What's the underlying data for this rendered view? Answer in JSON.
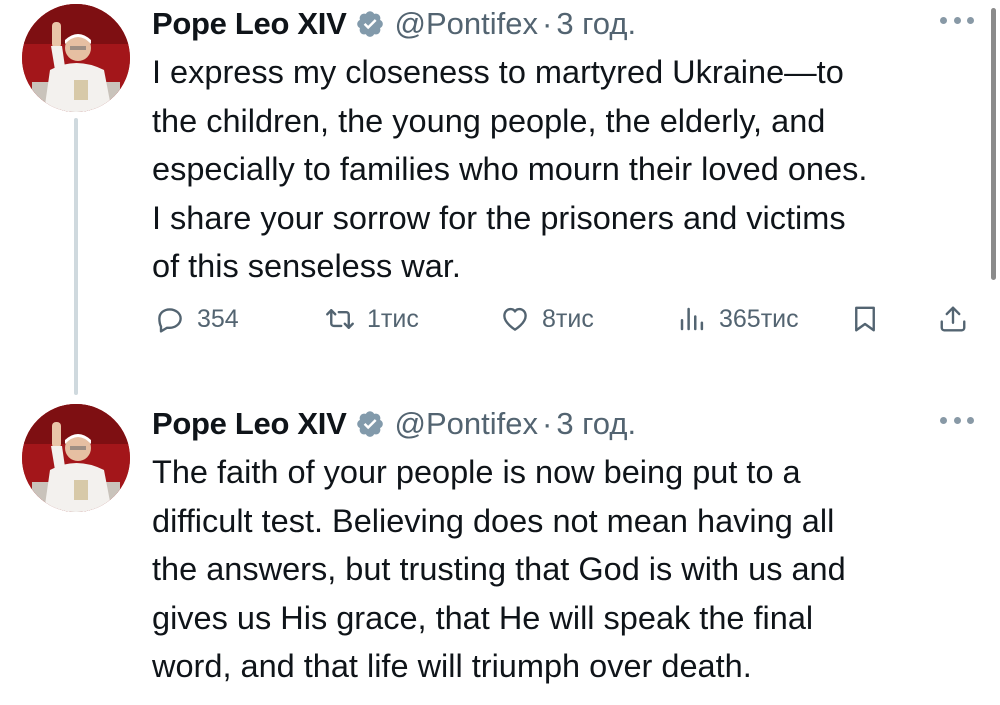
{
  "colors": {
    "text": "#0f1419",
    "secondary": "#536471",
    "verified_badge": "#829aab"
  },
  "tweets": [
    {
      "author_name": "Pope Leo XIV",
      "handle": "@Pontifex",
      "separator": "·",
      "time": "3 год.",
      "text_lines": [
        "I express my closeness to martyred Ukraine—to",
        "the children, the young people, the elderly, and",
        "especially to families who mourn their loved ones.",
        "I share your sorrow for the prisoners and victims",
        "of this senseless war."
      ],
      "stats": {
        "replies": "354",
        "reposts": "1тис",
        "likes": "8тис",
        "views": "365тис"
      }
    },
    {
      "author_name": "Pope Leo XIV",
      "handle": "@Pontifex",
      "separator": "·",
      "time": "3 год.",
      "text_lines": [
        "The faith of your people is now being put to a",
        "difficult test. Believing does not mean having all",
        "the answers, but trusting that God is with us and",
        "gives us His grace, that He will speak the final",
        "word, and that life will triumph over death."
      ]
    }
  ],
  "icons": [
    "reply-icon",
    "repost-icon",
    "like-icon",
    "views-icon",
    "bookmark-icon",
    "share-icon",
    "verified-badge-icon",
    "more-options-icon"
  ]
}
